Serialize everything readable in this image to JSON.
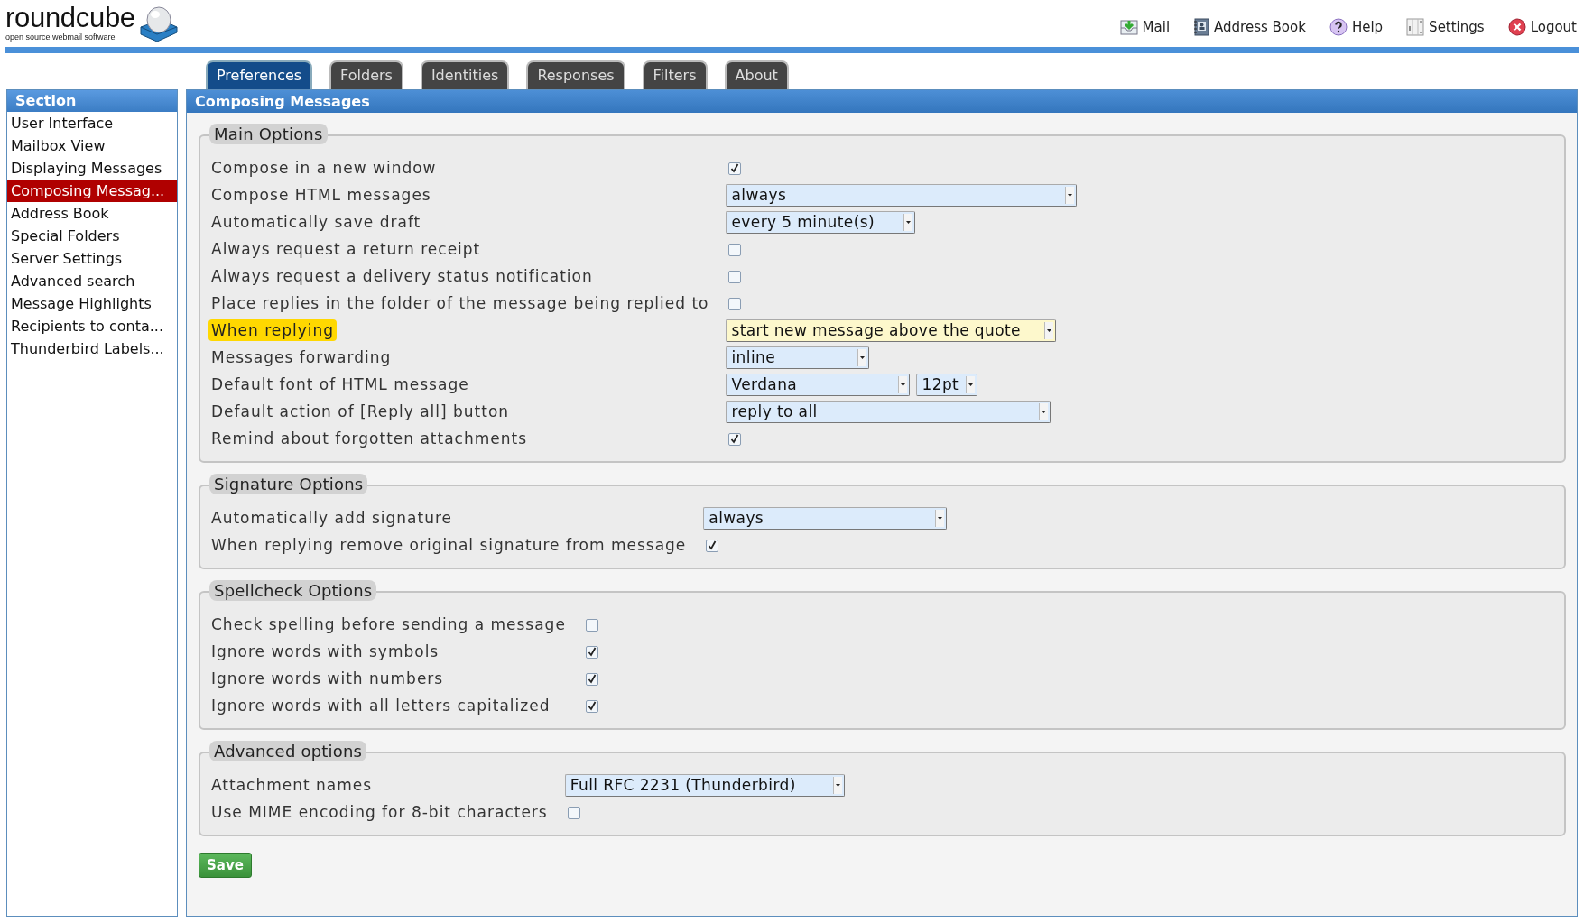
{
  "logo": {
    "name": "roundcube",
    "tagline": "open source webmail software"
  },
  "top_nav": [
    {
      "kind": "mail",
      "label": "Mail"
    },
    {
      "kind": "addressbook",
      "label": "Address Book"
    },
    {
      "kind": "help",
      "label": "Help"
    },
    {
      "kind": "settings",
      "label": "Settings"
    },
    {
      "kind": "logout",
      "label": "Logout"
    }
  ],
  "tabs": [
    {
      "label": "Preferences",
      "selected": true
    },
    {
      "label": "Folders",
      "selected": false
    },
    {
      "label": "Identities",
      "selected": false
    },
    {
      "label": "Responses",
      "selected": false
    },
    {
      "label": "Filters",
      "selected": false
    },
    {
      "label": "About",
      "selected": false
    }
  ],
  "sidebar": {
    "title": "Section",
    "items": [
      {
        "label": "User Interface",
        "selected": false
      },
      {
        "label": "Mailbox View",
        "selected": false
      },
      {
        "label": "Displaying Messages",
        "selected": false
      },
      {
        "label": "Composing Messag...",
        "selected": true
      },
      {
        "label": "Address Book",
        "selected": false
      },
      {
        "label": "Special Folders",
        "selected": false
      },
      {
        "label": "Server Settings",
        "selected": false
      },
      {
        "label": "Advanced search",
        "selected": false
      },
      {
        "label": "Message Highlights",
        "selected": false
      },
      {
        "label": "Recipients to conta...",
        "selected": false
      },
      {
        "label": "Thunderbird Labels...",
        "selected": false
      }
    ]
  },
  "panel": {
    "title": "Composing Messages",
    "fieldsets": [
      {
        "legend": "Main Options",
        "rows": [
          {
            "kind": "checkbox",
            "label": "Compose in a new window",
            "checked": true,
            "highlighted": false
          },
          {
            "kind": "select",
            "label": "Compose HTML messages",
            "values": [
              "always"
            ],
            "highlighted": false
          },
          {
            "kind": "select",
            "label": "Automatically save draft",
            "values": [
              "every 5 minute(s)"
            ],
            "highlighted": false
          },
          {
            "kind": "checkbox",
            "label": "Always request a return receipt",
            "checked": false,
            "highlighted": false
          },
          {
            "kind": "checkbox",
            "label": "Always request a delivery status notification",
            "checked": false,
            "highlighted": false
          },
          {
            "kind": "checkbox",
            "label": "Place replies in the folder of the message being replied to",
            "checked": false,
            "highlighted": false
          },
          {
            "kind": "select",
            "label": "When replying",
            "values": [
              "start new message above the quote"
            ],
            "highlighted": true
          },
          {
            "kind": "select",
            "label": "Messages forwarding",
            "values": [
              "inline"
            ],
            "highlighted": false
          },
          {
            "kind": "select",
            "label": "Default font of HTML message",
            "values": [
              "Verdana",
              "12pt"
            ],
            "highlighted": false
          },
          {
            "kind": "select",
            "label": "Default action of [Reply all] button",
            "values": [
              "reply to all"
            ],
            "highlighted": false
          },
          {
            "kind": "checkbox",
            "label": "Remind about forgotten attachments",
            "checked": true,
            "highlighted": false
          }
        ]
      },
      {
        "legend": "Signature Options",
        "rows": [
          {
            "kind": "select",
            "label": "Automatically add signature",
            "values": [
              "always"
            ],
            "highlighted": false
          },
          {
            "kind": "checkbox",
            "label": "When replying remove original signature from message",
            "checked": true,
            "highlighted": false
          }
        ]
      },
      {
        "legend": "Spellcheck Options",
        "rows": [
          {
            "kind": "checkbox",
            "label": "Check spelling before sending a message",
            "checked": false,
            "highlighted": false
          },
          {
            "kind": "checkbox",
            "label": "Ignore words with symbols",
            "checked": true,
            "highlighted": false
          },
          {
            "kind": "checkbox",
            "label": "Ignore words with numbers",
            "checked": true,
            "highlighted": false
          },
          {
            "kind": "checkbox",
            "label": "Ignore words with all letters capitalized",
            "checked": true,
            "highlighted": false
          }
        ]
      },
      {
        "legend": "Advanced options",
        "rows": [
          {
            "kind": "select",
            "label": "Attachment names",
            "values": [
              "Full RFC 2231 (Thunderbird)"
            ],
            "highlighted": false
          },
          {
            "kind": "checkbox",
            "label": "Use MIME encoding for 8-bit characters",
            "checked": false,
            "highlighted": false
          }
        ]
      }
    ],
    "save": "Save"
  }
}
